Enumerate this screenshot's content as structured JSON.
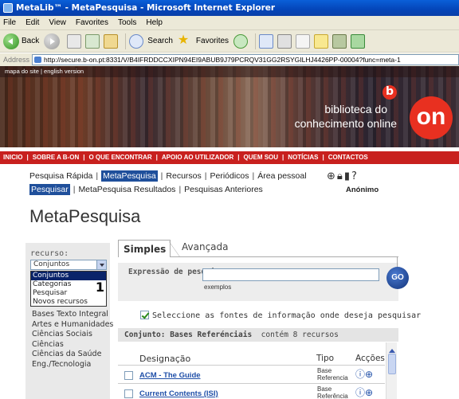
{
  "window": {
    "title": "MetaLib™ - MetaPesquisa - Microsoft Internet Explorer"
  },
  "menu": [
    "File",
    "Edit",
    "View",
    "Favorites",
    "Tools",
    "Help"
  ],
  "toolbar": {
    "back": "Back",
    "search": "Search",
    "favorites": "Favorites"
  },
  "address": {
    "label": "Address",
    "url": "http://secure.b-on.pt:8331/V/B4IFRDDCCXIPN94EI9ABUB9J79PCRQV31GG2RSYGILHJ4426PP-00004?func=meta-1"
  },
  "banner": {
    "site_links": "mapa do site  |  english version",
    "brand_line1": "biblioteca do",
    "brand_line2": "conhecimento online",
    "logo_small": "b",
    "logo_big": "on"
  },
  "rednav": [
    "INICIO",
    "SOBRE A B-ON",
    "O QUE ENCONTRAR",
    "APOIO AO UTILIZADOR",
    "QUEM SOU",
    "NOTÍCIAS",
    "CONTACTOS"
  ],
  "subnav1": [
    "Pesquisa Rápida",
    "MetaPesquisa",
    "Recursos",
    "Periódicos",
    "Área pessoal"
  ],
  "subnav2": [
    "Pesquisar",
    "MetaPesquisa Resultados",
    "Pesquisas Anteriores"
  ],
  "user": "Anónimo",
  "page_title": "MetaPesquisa",
  "left": {
    "label": "recurso:",
    "select_value": "Conjuntos",
    "options": [
      "Conjuntos",
      "Categorias",
      "Pesquisar",
      "Novos recursos"
    ],
    "categories": [
      "Bases Texto Integral",
      "Artes e Humanidades",
      "Ciências Sociais",
      "Ciências",
      "Ciências da Saúde",
      "Eng./Tecnologia"
    ]
  },
  "tabs": {
    "simples": "Simples",
    "avancada": "Avançada"
  },
  "search": {
    "label": "Expressão de pesquisa:",
    "value": "",
    "exemplos": "exemplos",
    "go": "GO"
  },
  "fontes": {
    "checked": true,
    "label": "Seleccione as fontes de informação onde deseja pesquisar"
  },
  "conjunto": {
    "prefix": "Conjunto:",
    "name": "Bases Referénciais",
    "suffix": "contém 8 recursos"
  },
  "table": {
    "headers": {
      "designacao": "Designação",
      "tipo": "Tipo",
      "accoes": "Acções"
    },
    "rows": [
      {
        "name": "ACM - The Guide",
        "tipo1": "Base",
        "tipo2": "Referencia"
      },
      {
        "name": "Current Contents (ISI)",
        "tipo1": "Base",
        "tipo2": "Referência"
      }
    ]
  },
  "colors": {
    "brand_red": "#c8201e",
    "nav_blue": "#1f4f9b",
    "link_blue": "#1f4fa8"
  }
}
